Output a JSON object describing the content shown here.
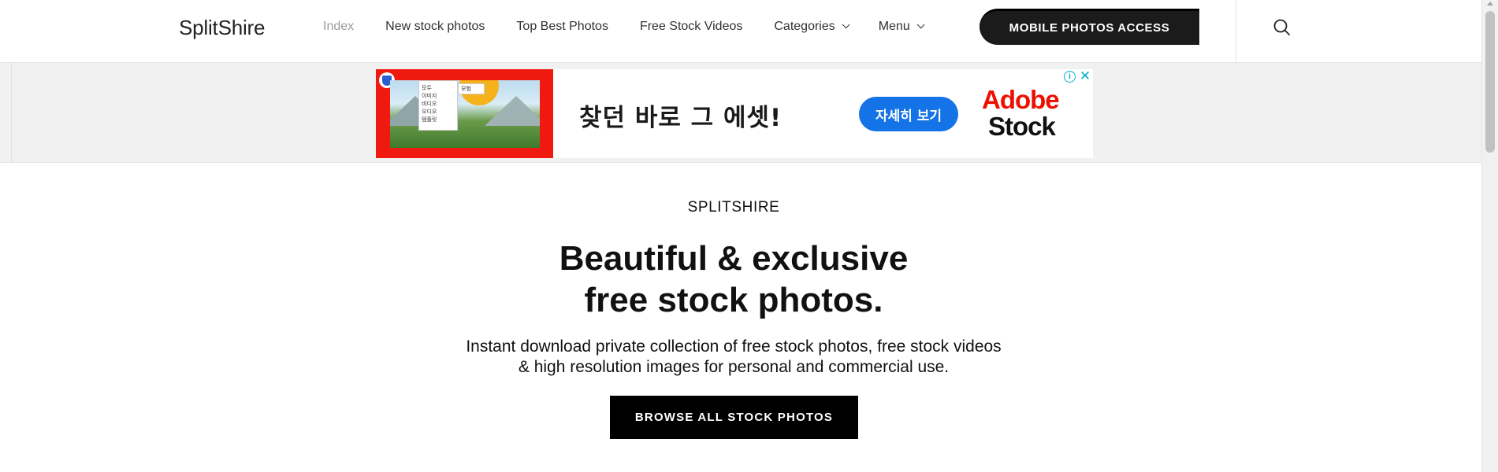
{
  "header": {
    "logo": "SplitShire",
    "nav": [
      {
        "label": "Index",
        "active": true,
        "dropdown": false
      },
      {
        "label": "New stock photos",
        "active": false,
        "dropdown": false
      },
      {
        "label": "Top Best Photos",
        "active": false,
        "dropdown": false
      },
      {
        "label": "Free Stock Videos",
        "active": false,
        "dropdown": false
      },
      {
        "label": "Categories",
        "active": false,
        "dropdown": true
      },
      {
        "label": "Menu",
        "active": false,
        "dropdown": true
      }
    ],
    "cta_label": "MOBILE PHOTOS ACCESS",
    "search_icon": "search-icon"
  },
  "ad": {
    "panel_items": [
      "모두",
      "이미지",
      "비디오",
      "오디오",
      "템플릿"
    ],
    "search_text": "모험",
    "headline": "찾던 바로 그 에셋!",
    "button_label": "자세히 보기",
    "brand_line1": "Adobe",
    "brand_line2": "Stock",
    "info_icon": "info-icon",
    "close_icon": "close-icon"
  },
  "hero": {
    "eyebrow": "SPLITSHIRE",
    "title_line1": "Beautiful & exclusive",
    "title_line2": "free stock photos.",
    "subtitle_line1": "Instant download private collection of free stock photos, free stock videos",
    "subtitle_line2": "& high resolution images for personal and commercial use.",
    "button_label": "BROWSE ALL STOCK PHOTOS"
  },
  "colors": {
    "active_nav": "#9a9a9a",
    "cta_bg": "#1b1b1b",
    "ad_red": "#f0190f",
    "ad_blue": "#1473e6",
    "adobe_red": "#eb1000",
    "ad_choices": "#00aecd"
  }
}
